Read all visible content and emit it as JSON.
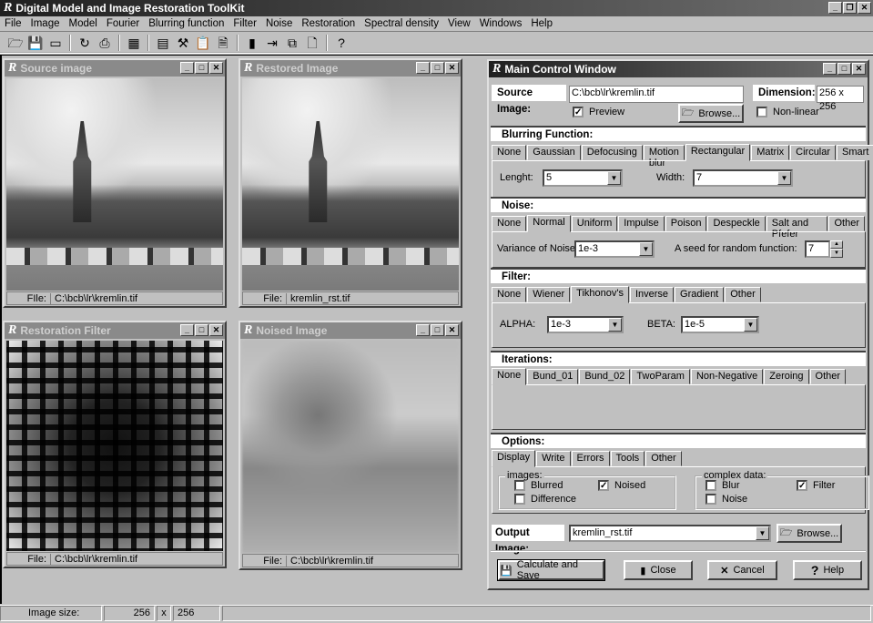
{
  "app": {
    "title": "Digital Model and Image Restoration ToolKit"
  },
  "menu": [
    "File",
    "Image",
    "Model",
    "Fourier",
    "Blurring function",
    "Filter",
    "Noise",
    "Restoration",
    "Spectral density",
    "View",
    "Windows",
    "Help"
  ],
  "toolbar": [
    {
      "icon": "open-folder-icon",
      "glyph": "🗁"
    },
    {
      "icon": "save-icon",
      "glyph": "💾"
    },
    {
      "icon": "folder-icon",
      "glyph": "▭"
    },
    {
      "sep": true
    },
    {
      "icon": "refresh-icon",
      "glyph": "↻"
    },
    {
      "icon": "print-icon",
      "glyph": "⎙"
    },
    {
      "sep": true
    },
    {
      "icon": "calculator-icon",
      "glyph": "▦"
    },
    {
      "sep": true
    },
    {
      "icon": "table-icon",
      "glyph": "▤"
    },
    {
      "icon": "tools-icon",
      "glyph": "⚒"
    },
    {
      "icon": "clipboard-icon",
      "glyph": "📋"
    },
    {
      "icon": "document-icon",
      "glyph": "🗎"
    },
    {
      "sep": true
    },
    {
      "icon": "chart-icon",
      "glyph": "▮"
    },
    {
      "icon": "export-icon",
      "glyph": "⇥"
    },
    {
      "icon": "copy-icon",
      "glyph": "⧉"
    },
    {
      "icon": "page-icon",
      "glyph": "🗋"
    },
    {
      "sep": true
    },
    {
      "icon": "help-icon",
      "glyph": "?"
    }
  ],
  "windows": {
    "source": {
      "title": "Source image",
      "file_label": "FIle:",
      "file": "C:\\bcb\\lr\\kremlin.tif"
    },
    "restored": {
      "title": "Restored Image",
      "file_label": "File:",
      "file": "kremlin_rst.tif"
    },
    "filter": {
      "title": "Restoration Filter",
      "file_label": "File:",
      "file": "C:\\bcb\\lr\\kremlin.tif"
    },
    "noised": {
      "title": "Noised Image",
      "file_label": "File:",
      "file": "C:\\bcb\\lr\\kremlin.tif"
    }
  },
  "control": {
    "title": "Main Control Window",
    "source_label": "Source Image:",
    "source_value": "C:\\bcb\\lr\\kremlin.tif",
    "dimension_label": "Dimension:",
    "dimension_value": "256 x 256",
    "preview": "Preview",
    "preview_checked": true,
    "browse": "Browse...",
    "nonlinear": "Non-linear",
    "nonlinear_checked": false,
    "blurring": {
      "header": "Blurring Function:",
      "tabs": [
        "None",
        "Gaussian",
        "Defocusing",
        "Motion blur",
        "Rectangular",
        "Matrix",
        "Circular",
        "Smart"
      ],
      "active": 4,
      "length_label": "Lenght:",
      "length": "5",
      "width_label": "Width:",
      "width": "7"
    },
    "noise": {
      "header": "Noise:",
      "tabs": [
        "None",
        "Normal",
        "Uniform",
        "Impulse",
        "Poison",
        "Despeckle",
        "Salt and Pfefer",
        "Other"
      ],
      "active": 1,
      "variance_label": "Variance of Noise:",
      "variance": "1e-3",
      "seed_label": "A seed for random function:",
      "seed": "7"
    },
    "filter": {
      "header": "Filter:",
      "tabs": [
        "None",
        "Wiener",
        "Tikhonov's",
        "Inverse",
        "Gradient",
        "Other"
      ],
      "active": 2,
      "alpha_label": "ALPHA:",
      "alpha": "1e-3",
      "beta_label": "BETA:",
      "beta": "1e-5"
    },
    "iterations": {
      "header": "Iterations:",
      "tabs": [
        "None",
        "Bund_01",
        "Bund_02",
        "TwoParam",
        "Non-Negative",
        "Zeroing",
        "Other"
      ],
      "active": 0
    },
    "options": {
      "header": "Options:",
      "tabs": [
        "Display",
        "Write",
        "Errors",
        "Tools",
        "Other"
      ],
      "active": 0,
      "images_group": "images:",
      "blurred": "Blurred",
      "noised": "Noised",
      "difference": "Difference",
      "complex_group": "complex data:",
      "blur": "Blur",
      "filter": "Filter",
      "noise": "Noise"
    },
    "output_label": "Output Image:",
    "output_value": "kremlin_rst.tif",
    "output_browse": "Browse...",
    "calc": "Calculate and Save",
    "close": "Close",
    "cancel": "Cancel",
    "help": "Help"
  },
  "status": {
    "label": "Image size:",
    "w": "256",
    "x": "x",
    "h": "256"
  }
}
